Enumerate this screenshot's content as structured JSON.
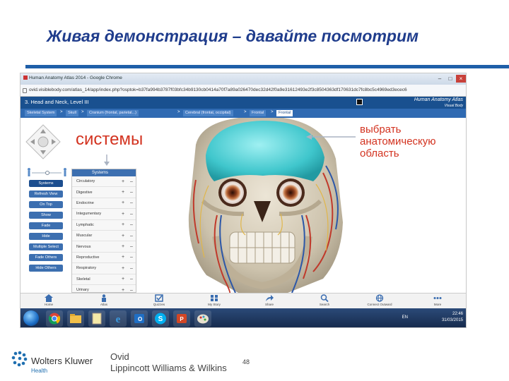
{
  "slide": {
    "title": "Живая демонстрация – давайте посмотрим",
    "page_number": "48",
    "annotation_left": "системы",
    "annotation_right": [
      "выбрать",
      "анатомическую",
      "область"
    ]
  },
  "browser": {
    "tab_title": "Human Anatomy Atlas 2014 - Google Chrome",
    "url": "ovid.visiblebody.com/atlas_14/app/index.php?osptok=b37fa994b3787f03bfc34b9130cb0414a70f7a89a026470dec32d42f0a9e31612493e2f3c8504363df170631dc7fc8bc5c4969ed3ecec6",
    "controls": [
      "–",
      "□",
      "×"
    ]
  },
  "app": {
    "location": "3. Head and Neck, Level III",
    "brand": "Human Anatomy Atlas",
    "brand_sub": "Visual Body",
    "breadcrumbs": [
      "Skeletal System",
      "Skull",
      "Cranium (frontal, parietal...)",
      "Cerebral (frontal, occipital)",
      "Frontal",
      "Frontal"
    ]
  },
  "side_menu": [
    "Systems",
    "Refresh View",
    "On Top",
    "Show",
    "Fade",
    "Hide",
    "Multiple Select",
    "Fade Others",
    "Hide Others"
  ],
  "systems_panel": {
    "title": "Systems",
    "rows": [
      "Circulatory",
      "Digestive",
      "Endocrine",
      "Integumentary",
      "Lymphatic",
      "Muscular",
      "Nervous",
      "Reproductive",
      "Respiratory",
      "Skeletal",
      "Urinary"
    ]
  },
  "toolbar": [
    "Home",
    "Atlas",
    "Quizzes",
    "My Story",
    "Share",
    "Search",
    "Connect Outward",
    "More"
  ],
  "taskbar": {
    "lang": "EN",
    "time": "22:46",
    "date": "31/03/2015"
  },
  "footer": {
    "company": "Wolters Kluwer",
    "company_sub": "Health",
    "ovid_line1": "Ovid",
    "ovid_line2": "Lippincott Williams & Wilkins"
  },
  "colors": {
    "title": "#1f3c8c",
    "accent_rule": "#1f5fa8",
    "annotation": "#d33320",
    "app_header": "#19508f"
  }
}
